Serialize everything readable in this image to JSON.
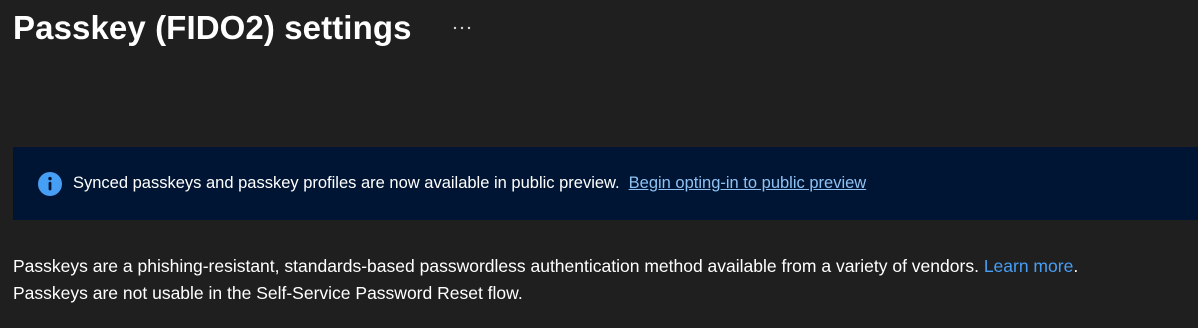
{
  "header": {
    "title": "Passkey (FIDO2) settings",
    "more_icon": "ellipsis-icon"
  },
  "banner": {
    "icon": "info-icon",
    "text": "Synced passkeys and passkey profiles are now available in public preview.",
    "link_label": "Begin opting-in to public preview",
    "background_color": "#001533",
    "link_color": "#8ec2f5"
  },
  "description": {
    "line1_text": "Passkeys are a phishing-resistant, standards-based passwordless authentication method available from a variety of vendors.",
    "learn_more_label": "Learn more",
    "line1_suffix": ".",
    "line2_text": "Passkeys are not usable in the Self-Service Password Reset flow.",
    "link_color": "#479ef5"
  },
  "colors": {
    "page_background": "#1f1f1f",
    "text": "#ffffff",
    "info_icon": "#479ef5"
  }
}
